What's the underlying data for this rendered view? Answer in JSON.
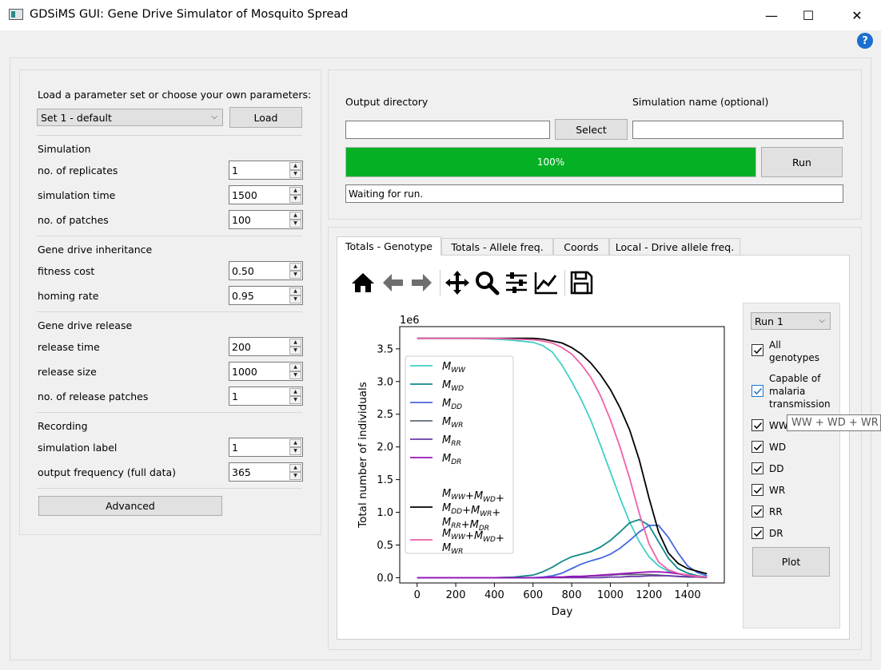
{
  "window": {
    "title": "GDSiMS GUI: Gene Drive Simulator of Mosquito Spread",
    "minimize": "—",
    "maximize": "☐",
    "close": "✕",
    "help": "?"
  },
  "params": {
    "load_label": "Load a parameter set or choose your own parameters:",
    "preset_selected": "Set 1 - default",
    "load_button": "Load",
    "sections": {
      "simulation": "Simulation",
      "inheritance": "Gene drive inheritance",
      "release": "Gene drive release",
      "recording": "Recording"
    },
    "fields": {
      "replicates": {
        "label": "no. of replicates",
        "value": "1"
      },
      "sim_time": {
        "label": "simulation time",
        "value": "1500"
      },
      "patches": {
        "label": "no. of patches",
        "value": "100"
      },
      "fitness_cost": {
        "label": "fitness cost",
        "value": "0.50"
      },
      "homing_rate": {
        "label": "homing rate",
        "value": "0.95"
      },
      "release_time": {
        "label": "release time",
        "value": "200"
      },
      "release_size": {
        "label": "release size",
        "value": "1000"
      },
      "release_patches": {
        "label": "no. of release patches",
        "value": "1"
      },
      "sim_label": {
        "label": "simulation label",
        "value": "1"
      },
      "output_freq": {
        "label": "output frequency (full data)",
        "value": "365"
      }
    },
    "advanced_button": "Advanced"
  },
  "output": {
    "dir_label": "Output directory",
    "name_label": "Simulation name (optional)",
    "dir_value": "",
    "name_value": "",
    "select_button": "Select",
    "progress_text": "100%",
    "progress_fraction": 1.0,
    "run_button": "Run",
    "status": "Waiting for run."
  },
  "tabs": [
    "Totals - Genotype",
    "Totals - Allele freq.",
    "Coords",
    "Local - Drive allele freq."
  ],
  "toolbar_icons": [
    "home-icon",
    "back-arrow-icon",
    "forward-arrow-icon",
    "pan-icon",
    "zoom-icon",
    "configure-subplots-icon",
    "edit-axis-icon",
    "save-icon"
  ],
  "controls": {
    "run_selected": "Run 1",
    "checkboxes": [
      {
        "label": "All genotypes",
        "checked": true
      },
      {
        "label": "Capable of malaria transmission",
        "checked": true
      },
      {
        "label": "WW",
        "checked": true
      },
      {
        "label": "WD",
        "checked": true
      },
      {
        "label": "DD",
        "checked": true
      },
      {
        "label": "WR",
        "checked": true
      },
      {
        "label": "RR",
        "checked": true
      },
      {
        "label": "DR",
        "checked": true
      }
    ],
    "plot_button": "Plot",
    "tooltip": "WW + WD + WR"
  },
  "chart_data": {
    "type": "line",
    "xlabel": "Day",
    "ylabel": "Total number of individuals",
    "offset_label": "1e6",
    "xlim": [
      -90,
      1590
    ],
    "ylim": [
      -0.08,
      3.84
    ],
    "x_ticks": [
      0,
      200,
      400,
      600,
      800,
      1000,
      1200,
      1400
    ],
    "y_ticks": [
      0.0,
      0.5,
      1.0,
      1.5,
      2.0,
      2.5,
      3.0,
      3.5
    ],
    "legend_position": "lower-left",
    "x": [
      0,
      100,
      200,
      300,
      400,
      500,
      600,
      650,
      700,
      750,
      800,
      850,
      900,
      950,
      1000,
      1050,
      1100,
      1150,
      1200,
      1250,
      1300,
      1350,
      1400,
      1450,
      1500
    ],
    "series": [
      {
        "name": "WW",
        "color": "#40d0c8",
        "values": [
          3.66,
          3.66,
          3.66,
          3.66,
          3.65,
          3.63,
          3.6,
          3.55,
          3.45,
          3.25,
          3.0,
          2.72,
          2.4,
          2.02,
          1.62,
          1.22,
          0.85,
          0.55,
          0.32,
          0.18,
          0.1,
          0.06,
          0.04,
          0.02,
          0.01
        ]
      },
      {
        "name": "WD",
        "color": "#108a88",
        "values": [
          0.0,
          0.0,
          0.0,
          0.0,
          0.0,
          0.01,
          0.04,
          0.09,
          0.16,
          0.25,
          0.32,
          0.36,
          0.4,
          0.47,
          0.57,
          0.7,
          0.84,
          0.89,
          0.8,
          0.55,
          0.3,
          0.14,
          0.07,
          0.03,
          0.01
        ]
      },
      {
        "name": "DD",
        "color": "#4466dd",
        "values": [
          0.0,
          0.0,
          0.0,
          0.0,
          0.0,
          0.0,
          0.0,
          0.01,
          0.03,
          0.07,
          0.14,
          0.21,
          0.26,
          0.3,
          0.36,
          0.45,
          0.57,
          0.7,
          0.8,
          0.8,
          0.62,
          0.38,
          0.18,
          0.08,
          0.03
        ]
      },
      {
        "name": "WR",
        "color": "#606878",
        "values": [
          0.0,
          0.0,
          0.0,
          0.0,
          0.0,
          0.0,
          0.0,
          0.0,
          0.01,
          0.01,
          0.02,
          0.02,
          0.03,
          0.03,
          0.04,
          0.05,
          0.05,
          0.05,
          0.05,
          0.04,
          0.03,
          0.02,
          0.01,
          0.01,
          0.0
        ]
      },
      {
        "name": "RR",
        "color": "#6a3aa8",
        "values": [
          0.0,
          0.0,
          0.0,
          0.0,
          0.0,
          0.0,
          0.0,
          0.0,
          0.0,
          0.0,
          0.0,
          0.0,
          0.0,
          0.0,
          0.01,
          0.01,
          0.02,
          0.02,
          0.03,
          0.03,
          0.03,
          0.02,
          0.02,
          0.01,
          0.01
        ]
      },
      {
        "name": "DR",
        "color": "#9a10b8",
        "values": [
          0.0,
          0.0,
          0.0,
          0.0,
          0.0,
          0.0,
          0.0,
          0.0,
          0.01,
          0.01,
          0.02,
          0.02,
          0.03,
          0.04,
          0.05,
          0.06,
          0.07,
          0.08,
          0.09,
          0.09,
          0.08,
          0.06,
          0.04,
          0.02,
          0.01
        ]
      },
      {
        "name": "All genotypes",
        "color": "#000000",
        "values": [
          3.66,
          3.66,
          3.66,
          3.66,
          3.66,
          3.66,
          3.66,
          3.65,
          3.62,
          3.59,
          3.52,
          3.42,
          3.28,
          3.1,
          2.88,
          2.6,
          2.26,
          1.8,
          1.22,
          0.7,
          0.38,
          0.22,
          0.14,
          0.1,
          0.06
        ]
      },
      {
        "name": "Capable of malaria transmission",
        "color": "#f060a8",
        "values": [
          3.66,
          3.66,
          3.66,
          3.66,
          3.66,
          3.65,
          3.64,
          3.62,
          3.59,
          3.52,
          3.42,
          3.26,
          3.06,
          2.78,
          2.42,
          2.0,
          1.52,
          0.98,
          0.52,
          0.24,
          0.12,
          0.07,
          0.04,
          0.02,
          0.01
        ]
      }
    ]
  }
}
